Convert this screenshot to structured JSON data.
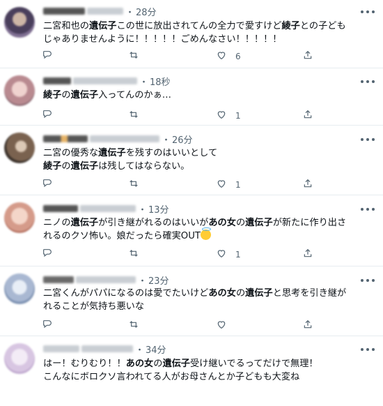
{
  "tweets": [
    {
      "time": "28分",
      "segments": [
        [
          {
            "t": "二宮和也の",
            "b": false
          },
          {
            "t": "遺伝子",
            "b": true
          },
          {
            "t": "この世に放出されてんの全力で愛すけど",
            "b": false
          },
          {
            "t": "綾子",
            "b": true
          },
          {
            "t": "との子ども",
            "b": false
          }
        ],
        [
          {
            "t": "じゃありませんように！！！！！ごめんなさい！！！！！",
            "b": false
          }
        ]
      ],
      "like_count": "6",
      "avatar_color": "#6a5a78"
    },
    {
      "time": "18秒",
      "segments": [
        [
          {
            "t": "綾子",
            "b": true
          },
          {
            "t": "の",
            "b": false
          },
          {
            "t": "遺伝子",
            "b": true
          },
          {
            "t": "入ってんのかぁ…",
            "b": false
          }
        ]
      ],
      "like_count": "1",
      "avatar_color": "#c7a0a6"
    },
    {
      "time": "26分",
      "segments": [
        [
          {
            "t": "二宮の優秀な",
            "b": false
          },
          {
            "t": "遺伝子",
            "b": true
          },
          {
            "t": "を残すのはいいとして",
            "b": false
          }
        ],
        [
          {
            "t": "綾子",
            "b": true
          },
          {
            "t": "の",
            "b": false
          },
          {
            "t": "遺伝子",
            "b": true
          },
          {
            "t": "は残してはならない。",
            "b": false
          }
        ]
      ],
      "like_count": "1",
      "avatar_color": "#6b5747"
    },
    {
      "time": "13分",
      "segments": [
        [
          {
            "t": "ニノの",
            "b": false
          },
          {
            "t": "遺伝子",
            "b": true
          },
          {
            "t": "が引き継がれるのはいいが",
            "b": false
          },
          {
            "t": "あの女",
            "b": true
          },
          {
            "t": "の",
            "b": false
          },
          {
            "t": "遺伝子",
            "b": true
          },
          {
            "t": "が新たに作り出さ",
            "b": false
          }
        ],
        [
          {
            "t": "れるのクソ怖い。娘だったら確実OUT",
            "b": false
          }
        ]
      ],
      "like_count": "1",
      "avatar_color": "#e7b4ac"
    },
    {
      "time": "23分",
      "segments": [
        [
          {
            "t": "二宮くんがパパになるのは愛でたいけど",
            "b": false
          },
          {
            "t": "あの女",
            "b": true
          },
          {
            "t": "の",
            "b": false
          },
          {
            "t": "遺伝子",
            "b": true
          },
          {
            "t": "と思考を引き継が",
            "b": false
          }
        ],
        [
          {
            "t": "れることが気持ち悪いな",
            "b": false
          }
        ]
      ],
      "like_count": "",
      "avatar_color": "#b7c3d8"
    },
    {
      "time": "34分",
      "segments": [
        [
          {
            "t": "はー！むりむり！！",
            "b": false
          },
          {
            "t": "あの女",
            "b": true
          },
          {
            "t": "の",
            "b": false
          },
          {
            "t": "遺伝子",
            "b": true
          },
          {
            "t": "受け継いでるってだけで無理！",
            "b": false
          }
        ],
        [
          {
            "t": "こんなにボロクソ言われてる人がお母さんとか子どもも大変ね",
            "b": false
          }
        ]
      ],
      "like_count": "",
      "avatar_color": "#d7c3e0"
    }
  ]
}
